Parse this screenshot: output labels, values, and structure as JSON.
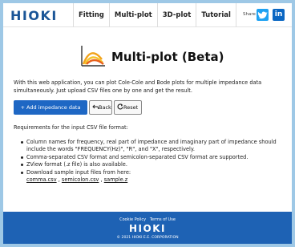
{
  "header": {
    "logo": "HIOKI",
    "nav": [
      "Fitting",
      "Multi-plot",
      "3D-plot",
      "Tutorial"
    ],
    "share_label": "Share",
    "linkedin_glyph": "in"
  },
  "main": {
    "title": "Multi-plot (Beta)",
    "intro": "With this web application, you can plot Cole-Cole and Bode plots for multiple impedance data simultaneously. Just upload CSV files one by one and get the result.",
    "add_button": "+ Add impedance data",
    "back_button": "Back",
    "reset_button": "Reset",
    "requirements_heading": "Requirements for the input CSV file format:",
    "bullets": [
      "Column names for frequency, real part of impedance and imaginary part of impedance should include the words \"FREQUENCY(Hz)\", \"R\", and \"X\", respectively.",
      "Comma-separated CSV format and semicolon-separated CSV format are supported.",
      "ZView format (.z file) is also available.",
      "Download sample input files from here:"
    ],
    "sample_links": [
      "comma.csv",
      "semicolon.csv",
      "sample.z"
    ],
    "link_separator": " , "
  },
  "footer": {
    "cookie_policy": "Cookie Policy",
    "terms": "Terms of Use",
    "logo": "HIOKI",
    "copyright": "© 2021 HIOKI E.E. CORPORATION"
  },
  "colors": {
    "brand": "#1a5597",
    "primary_button": "#1e67c4",
    "footer": "#1e62b4",
    "background": "#9ec8e6"
  },
  "icons": [
    "twitter-icon",
    "linkedin-icon",
    "multiplot-chart-icon",
    "back-arrow-icon",
    "reset-icon"
  ]
}
